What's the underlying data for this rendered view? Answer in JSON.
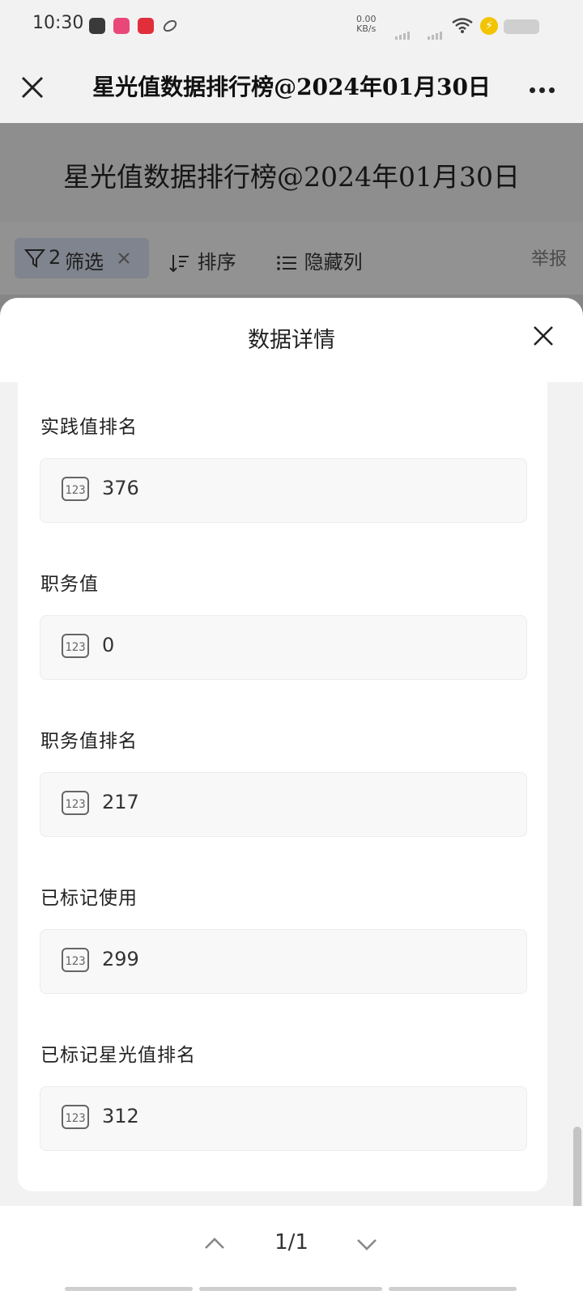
{
  "status_bar": {
    "time": "10:30",
    "net_speed_value": "0.00",
    "net_speed_unit": "KB/s",
    "icons": [
      "media-player-app-icon",
      "pink-app-icon",
      "red-app-icon",
      "link-app-icon",
      "wifi-icon",
      "charging-icon",
      "battery-icon"
    ]
  },
  "navbar": {
    "title": "星光值数据排行榜@2024年01月30日"
  },
  "background": {
    "title": "星光值数据排行榜@2024年01月30日",
    "filter_count": "2",
    "filter_label": "筛选",
    "sort_label": "排序",
    "hide_columns_label": "隐藏列",
    "report_label": "举报"
  },
  "sheet": {
    "title": "数据详情",
    "fields": [
      {
        "label": "实践值排名",
        "value": "376"
      },
      {
        "label": "职务值",
        "value": "0"
      },
      {
        "label": "职务值排名",
        "value": "217"
      },
      {
        "label": "已标记使用",
        "value": "299"
      },
      {
        "label": "已标记星光值排名",
        "value": "312"
      }
    ]
  },
  "pager": {
    "text": "1/1"
  }
}
